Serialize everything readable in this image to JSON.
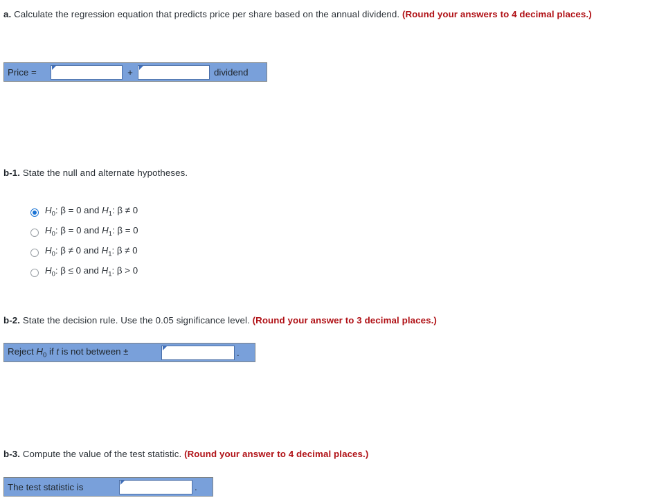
{
  "question_a": {
    "label": "a.",
    "text": " Calculate the regression equation that predicts price per share based on the annual dividend. ",
    "round_note": "(Round your answers to 4 decimal places.)"
  },
  "answer_a": {
    "price_label": "Price =",
    "operator": "+",
    "trailing_label": "dividend",
    "intercept_value": "",
    "intercept_placeholder": "",
    "slope_value": "",
    "slope_placeholder": ""
  },
  "question_b1": {
    "label": "b-1.",
    "text": " State the null and alternate hypotheses."
  },
  "hypothesis_options": [
    {
      "id": "option-1",
      "selected": true,
      "null_symbol": "H",
      "null_sub": "0",
      "null_expr": ": β = 0 and ",
      "alt_symbol": "H",
      "alt_sub": "1",
      "alt_expr": ": β ≠ 0",
      "plain": "H0: β = 0 and H1: β ≠ 0"
    },
    {
      "id": "option-2",
      "selected": false,
      "null_symbol": "H",
      "null_sub": "0",
      "null_expr": ": β = 0 and ",
      "alt_symbol": "H",
      "alt_sub": "1",
      "alt_expr": ": β = 0",
      "plain": "H0: β = 0 and H1: β = 0"
    },
    {
      "id": "option-3",
      "selected": false,
      "null_symbol": "H",
      "null_sub": "0",
      "null_expr": ": β ≠ 0 and ",
      "alt_symbol": "H",
      "alt_sub": "1",
      "alt_expr": ": β ≠ 0",
      "plain": "H0: β ≠ 0 and H1: β ≠ 0"
    },
    {
      "id": "option-4",
      "selected": false,
      "null_symbol": "H",
      "null_sub": "0",
      "null_expr": ": β ≤ 0 and ",
      "alt_symbol": "H",
      "alt_sub": "1",
      "alt_expr": ": β > 0",
      "plain": "H0: β ≤ 0 and H1: β > 0"
    }
  ],
  "question_b2": {
    "label": "b-2.",
    "text": " State the decision rule. Use the 0.05 significance level. ",
    "round_note": "(Round your answer to 3 decimal places.)"
  },
  "answer_b2": {
    "prefix_reject": "Reject ",
    "prefix_h": "H",
    "prefix_sub": "0",
    "prefix_mid": " if ",
    "prefix_t": "t",
    "prefix_tail": " is not between ±",
    "value": "",
    "placeholder": "",
    "period": "."
  },
  "question_b3": {
    "label": "b-3.",
    "text": " Compute the value of the test statistic. ",
    "round_note": "(Round your answer to 4 decimal places.)"
  },
  "answer_b3": {
    "prefix": "The test statistic is",
    "value": "",
    "placeholder": "",
    "period": "."
  },
  "colors": {
    "cell_blue": "#79a0da",
    "table_border": "#7d8489",
    "input_border": "#4a6fa8",
    "flag_blue": "#3f6fbb",
    "round_note_red": "#b01116",
    "radio_selected": "#1a73d4",
    "text": "#2b3137"
  }
}
